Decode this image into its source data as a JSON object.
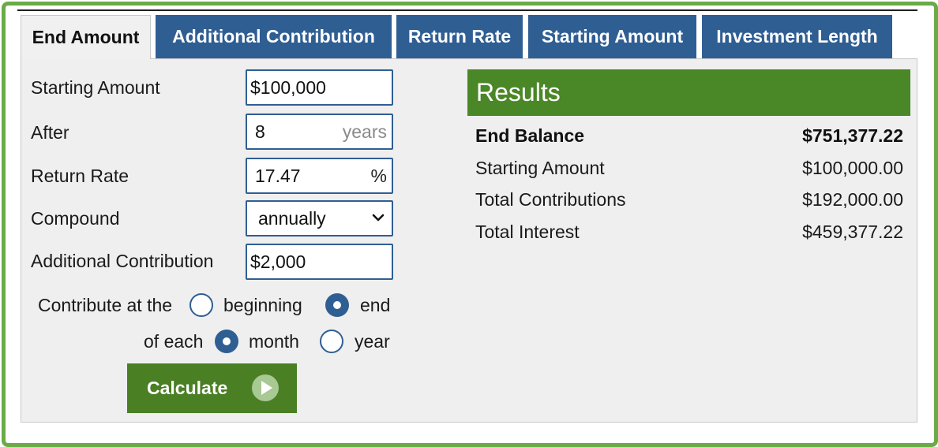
{
  "tabs": [
    {
      "label": "End Amount",
      "active": true
    },
    {
      "label": "Additional Contribution",
      "active": false
    },
    {
      "label": "Return Rate",
      "active": false
    },
    {
      "label": "Starting Amount",
      "active": false
    },
    {
      "label": "Investment Length",
      "active": false
    }
  ],
  "form": {
    "starting_amount": {
      "label": "Starting Amount",
      "value": "$100,000"
    },
    "after": {
      "label": "After",
      "value": "8",
      "unit": "years"
    },
    "return_rate": {
      "label": "Return Rate",
      "value": "17.47",
      "unit": "%"
    },
    "compound": {
      "label": "Compound",
      "selected": "annually"
    },
    "additional_contribution": {
      "label": "Additional Contribution",
      "value": "$2,000"
    },
    "contribute_at": {
      "prefix": "Contribute at the",
      "options": [
        "beginning",
        "end"
      ],
      "selected": "end"
    },
    "each": {
      "prefix": "of each",
      "options": [
        "month",
        "year"
      ],
      "selected": "month"
    },
    "calculate_label": "Calculate"
  },
  "results": {
    "title": "Results",
    "rows": [
      {
        "label": "End Balance",
        "value": "$751,377.22",
        "bold": true
      },
      {
        "label": "Starting Amount",
        "value": "$100,000.00",
        "bold": false
      },
      {
        "label": "Total Contributions",
        "value": "$192,000.00",
        "bold": false
      },
      {
        "label": "Total Interest",
        "value": "$459,377.22",
        "bold": false
      }
    ]
  },
  "colors": {
    "frame": "#6aab48",
    "tab_blue": "#2f5e93",
    "results_green": "#4a8726",
    "button_green": "#4a7f24",
    "panel_bg": "#efefef"
  },
  "icons": {
    "compound_dropdown": "chevron-down-icon",
    "calculate_button": "play-circle-icon"
  }
}
